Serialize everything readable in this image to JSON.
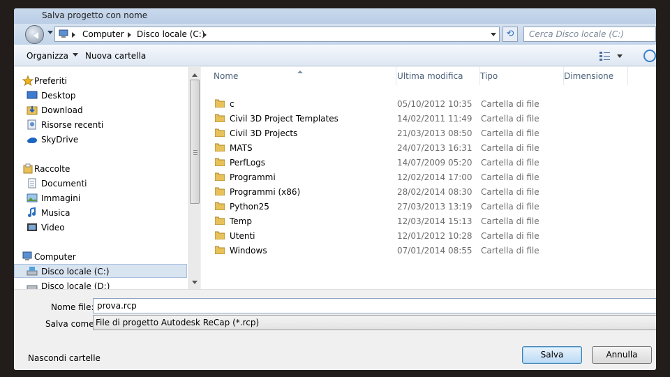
{
  "window": {
    "title": "Salva progetto con nome"
  },
  "address": {
    "crumbs": [
      "Computer",
      "Disco locale (C:)"
    ],
    "search_placeholder": "Cerca Disco locale (C:)"
  },
  "toolbar": {
    "organize": "Organizza",
    "new_folder": "Nuova cartella"
  },
  "nav": {
    "items": [
      {
        "label": "Preferiti",
        "icon": "star-icon",
        "group": true
      },
      {
        "label": "Desktop",
        "icon": "desktop-icon"
      },
      {
        "label": "Download",
        "icon": "download-folder-icon"
      },
      {
        "label": "Risorse recenti",
        "icon": "recent-places-icon"
      },
      {
        "label": "SkyDrive",
        "icon": "cloud-icon"
      },
      {
        "label": "Raccolte",
        "icon": "libraries-icon",
        "group": true
      },
      {
        "label": "Documenti",
        "icon": "documents-icon"
      },
      {
        "label": "Immagini",
        "icon": "pictures-icon"
      },
      {
        "label": "Musica",
        "icon": "music-icon"
      },
      {
        "label": "Video",
        "icon": "video-icon"
      },
      {
        "label": "Computer",
        "icon": "computer-icon",
        "group": true
      },
      {
        "label": "Disco locale (C:)",
        "icon": "drive-icon",
        "selected": true
      },
      {
        "label": "Disco locale (D:)",
        "icon": "drive-icon"
      }
    ]
  },
  "columns": {
    "name": "Nome",
    "modified": "Ultima modifica",
    "type": "Tipo",
    "size": "Dimensione"
  },
  "files": [
    {
      "name": "c",
      "modified": "05/10/2012 10:35",
      "type": "Cartella di file"
    },
    {
      "name": "Civil 3D Project Templates",
      "modified": "14/02/2011 11:49",
      "type": "Cartella di file"
    },
    {
      "name": "Civil 3D Projects",
      "modified": "21/03/2013 08:50",
      "type": "Cartella di file"
    },
    {
      "name": "MATS",
      "modified": "24/07/2013 16:31",
      "type": "Cartella di file"
    },
    {
      "name": "PerfLogs",
      "modified": "14/07/2009 05:20",
      "type": "Cartella di file"
    },
    {
      "name": "Programmi",
      "modified": "12/02/2014 17:00",
      "type": "Cartella di file"
    },
    {
      "name": "Programmi (x86)",
      "modified": "28/02/2014 08:30",
      "type": "Cartella di file"
    },
    {
      "name": "Python25",
      "modified": "27/03/2013 13:19",
      "type": "Cartella di file"
    },
    {
      "name": "Temp",
      "modified": "12/03/2014 15:13",
      "type": "Cartella di file"
    },
    {
      "name": "Utenti",
      "modified": "12/01/2012 10:28",
      "type": "Cartella di file"
    },
    {
      "name": "Windows",
      "modified": "07/01/2014 08:55",
      "type": "Cartella di file"
    }
  ],
  "form": {
    "filename_label": "Nome file:",
    "filename_value": "prova.rcp",
    "type_label": "Salva come:",
    "type_value": "File di progetto Autodesk ReCap (*.rcp)",
    "hide_folders": "Nascondi cartelle",
    "save": "Salva",
    "cancel": "Annulla"
  },
  "colors": {
    "folder": "#e8c15a",
    "accent": "#3c7fb1",
    "selection": "#d9e4f1"
  }
}
